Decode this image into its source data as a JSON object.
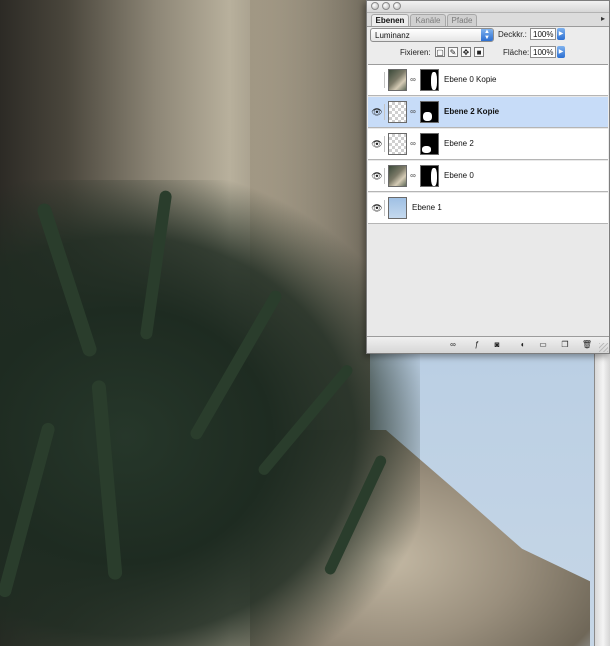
{
  "palette": {
    "tabs": [
      "Ebenen",
      "Kanäle",
      "Pfade"
    ],
    "blend_mode": "Luminanz",
    "opacity_label": "Deckkr.:",
    "opacity_value": "100%",
    "lock_label": "Fixieren:",
    "fill_label": "Fläche:",
    "fill_value": "100%",
    "layers": [
      {
        "name": "Ebene 0 Kopie",
        "visible": false,
        "selected": false
      },
      {
        "name": "Ebene 2 Kopie",
        "visible": true,
        "selected": true
      },
      {
        "name": "Ebene 2",
        "visible": true,
        "selected": false
      },
      {
        "name": "Ebene 0",
        "visible": true,
        "selected": false
      },
      {
        "name": "Ebene 1",
        "visible": true,
        "selected": false
      }
    ],
    "bottom_icons": [
      "link-icon",
      "layer-style-icon",
      "mask-icon",
      "adjustment-icon",
      "new-group-icon",
      "new-layer-icon",
      "trash-icon"
    ]
  },
  "colors": {
    "selected_row": "#c7dcf8",
    "accent": "#2c6fd1"
  }
}
